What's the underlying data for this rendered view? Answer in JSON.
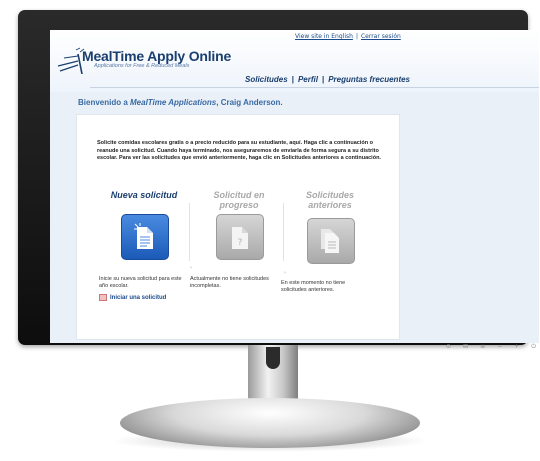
{
  "header": {
    "links": {
      "english": "View site in English",
      "logout": "Cerrar sesión",
      "separator": "|"
    },
    "logo": {
      "title": "MealTime Apply Online",
      "subtitle": "Applications for Free & Reduced Meals"
    },
    "nav": [
      "Solicitudes",
      "Perfil",
      "Preguntas frecuentes"
    ],
    "nav_separator": "|"
  },
  "welcome": {
    "prefix": "Bienvenido a ",
    "app": "MealTime Applications",
    "suffix": ", Craig Anderson."
  },
  "intro": "Solicite comidas escolares gratis o a precio reducido para su estudiante, aquí. Haga clic a continuación o reanude una solicitud. Cuando haya terminado, nos aseguraremos de enviarla de forma segura a su distrito escolar. Para ver las solicitudes que envió anteriormente, haga clic en Solicitudes anteriores a continuación.",
  "columns": [
    {
      "title": "Nueva solicitud",
      "description": "Inicie su nueva solicitud para este año escolar.",
      "link": "Iniciar una solicitud",
      "icon": "new-document-icon",
      "color": "#2a6fd0"
    },
    {
      "title": "Solicitud en progreso",
      "description": "Actualmente no tiene solicitudes incompletas.",
      "icon": "document-question-icon",
      "color": "#b8b8b8"
    },
    {
      "title": "Solicitudes anteriores",
      "description": "En este momento no tiene solicitudes anteriores.",
      "icon": "stacked-documents-icon",
      "color": "#b8b8b8"
    }
  ]
}
